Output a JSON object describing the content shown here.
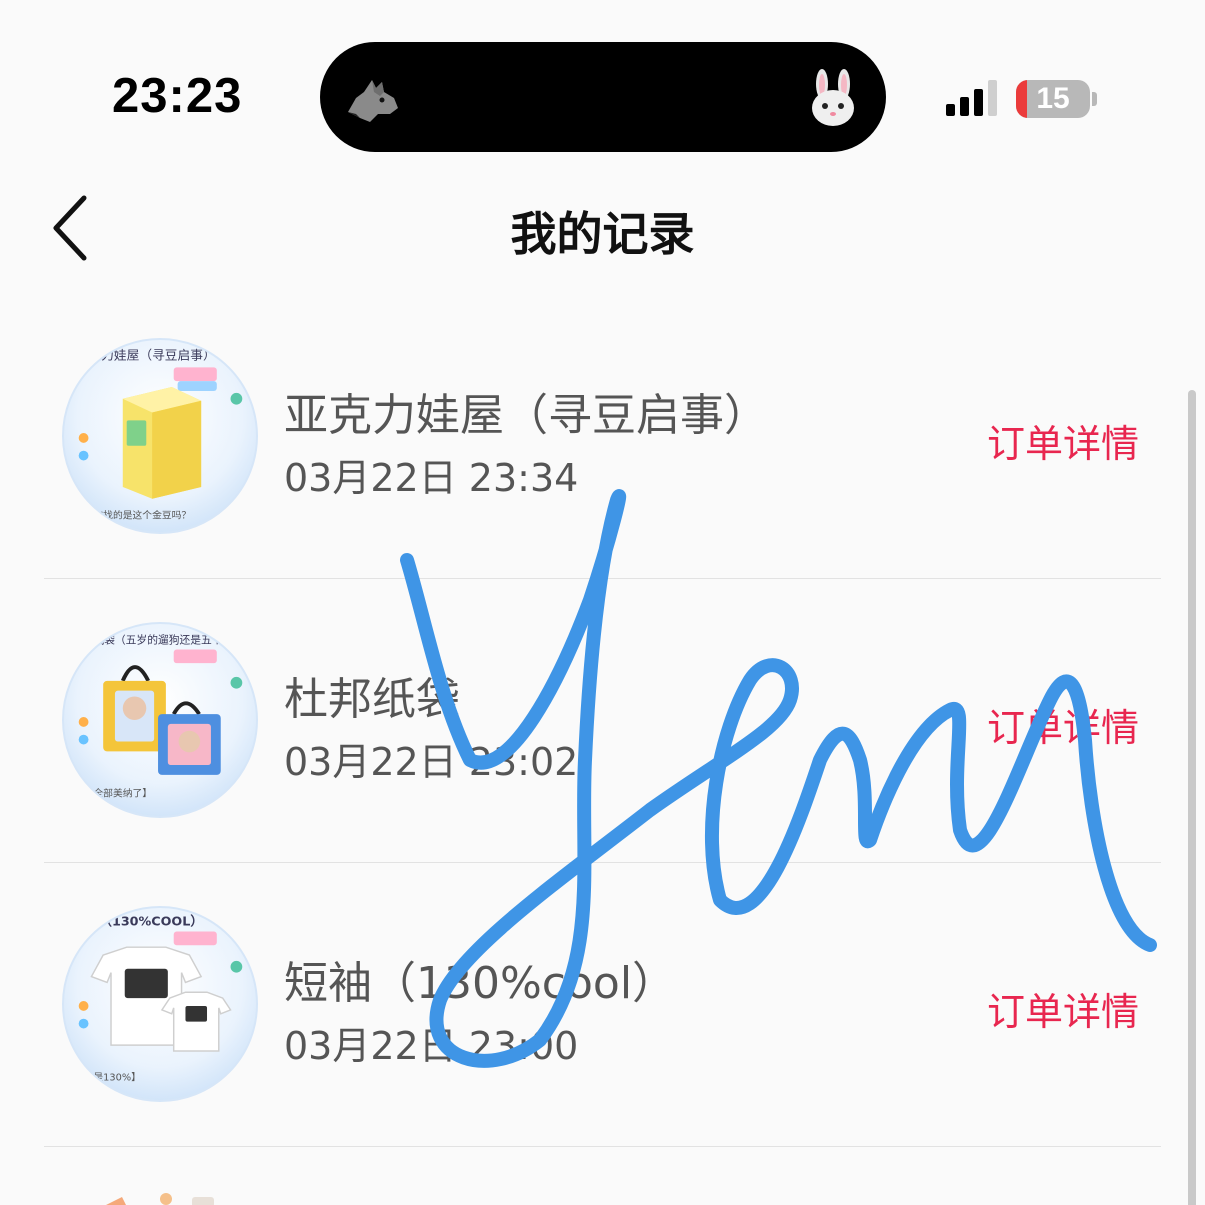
{
  "status_bar": {
    "time": "23:23",
    "battery_percent": "15",
    "battery_level": 0.15,
    "signal_bars_active": 3,
    "island_icons": [
      "wolf-icon",
      "rabbit-icon"
    ]
  },
  "nav": {
    "title": "我的记录",
    "back_icon": "chevron-left-icon"
  },
  "records": [
    {
      "name": "亚克力娃屋（寻豆启事）",
      "date": "03月22日 23:34",
      "action": "订单详情",
      "thumb_label": "力娃屋（寻豆启事）"
    },
    {
      "name": "杜邦纸袋",
      "date": "03月22日 23:02",
      "action": "订单详情",
      "thumb_label": "纸袋（五岁的遛狗还是五个遛狗"
    },
    {
      "name": "短袖（130%cool）",
      "date": "03月22日 23:00",
      "action": "订单详情",
      "thumb_label": "（130%COOL）"
    }
  ],
  "colors": {
    "action_red": "#e8264f",
    "signature_blue": "#3f95e6",
    "text_gray": "#555555"
  }
}
